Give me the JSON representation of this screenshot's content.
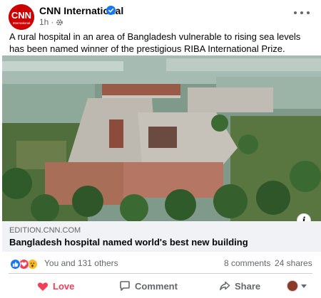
{
  "post": {
    "page_name": "CNN International",
    "avatar_text": "CNN",
    "avatar_subtext": "International",
    "time": "1h",
    "dot": "·",
    "caption": "A rural hospital in an area of Bangladesh vulnerable to rising sea levels has been named winner of the prestigious RIBA International Prize.",
    "link": {
      "domain": "EDITION.CNN.COM",
      "title": "Bangladesh hospital named world's best new building"
    },
    "info_icon": "i"
  },
  "stats": {
    "reactions_text": "You and 131 others",
    "comments": "8 comments",
    "shares": "24 shares",
    "reaction_types": [
      "like-icon",
      "love-icon",
      "wow-icon"
    ]
  },
  "actions": {
    "love": "Love",
    "comment": "Comment",
    "share": "Share"
  },
  "colors": {
    "cnn_red": "#cc0000",
    "verified_blue": "#1877f2",
    "love_red": "#f33e58",
    "secondary_text": "#65676b",
    "link_bg": "#f0f2f5"
  }
}
